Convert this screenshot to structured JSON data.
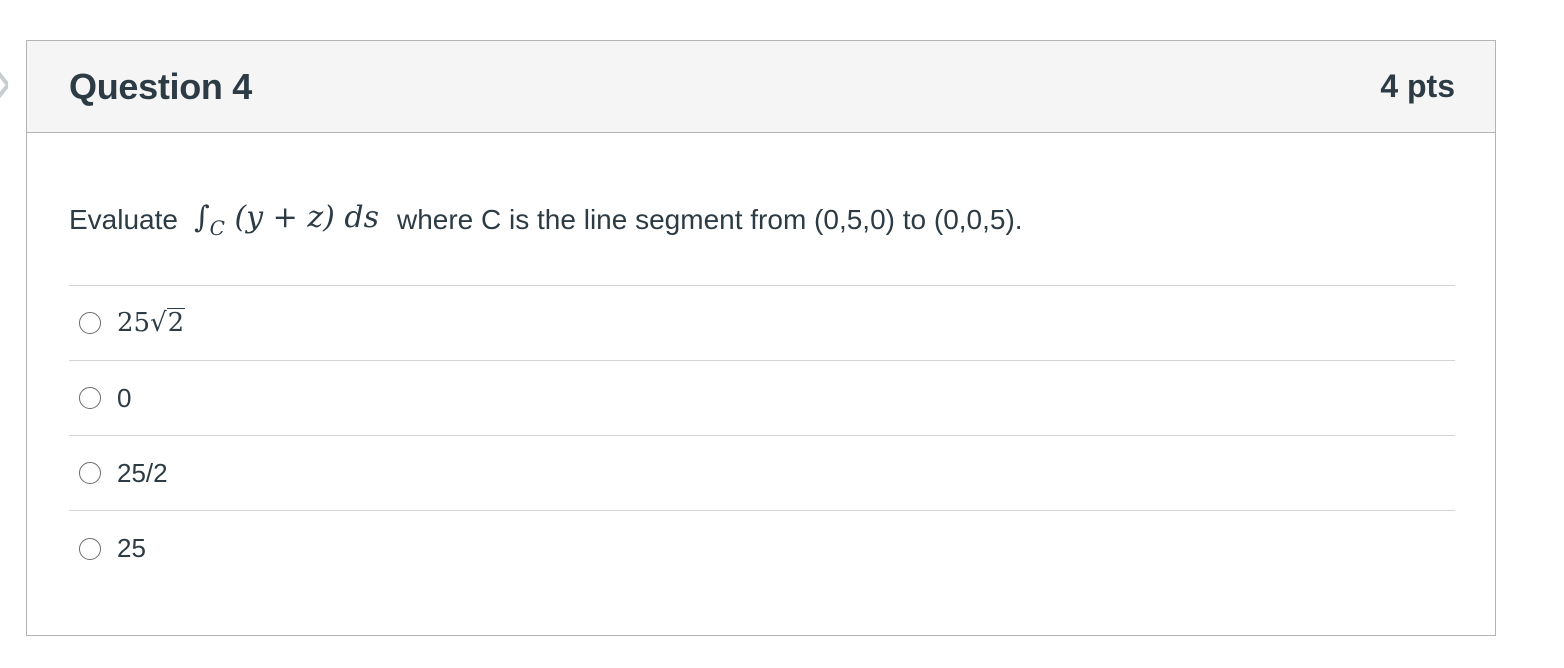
{
  "question": {
    "title": "Question 4",
    "points": "4 pts",
    "prompt_before": "Evaluate",
    "math_integral": "∫",
    "math_subscript": "C",
    "math_expr": "(y + z) ds",
    "prompt_after": "where C is the line segment from (0,5,0) to (0,0,5).",
    "options": [
      {
        "coef": "25",
        "radical_sign": "√",
        "radicand": "2"
      },
      {
        "label": "0"
      },
      {
        "label": "25/2"
      },
      {
        "label": "25"
      }
    ]
  }
}
